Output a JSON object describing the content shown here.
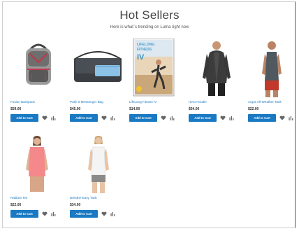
{
  "section": {
    "title": "Hot Sellers",
    "subtitle": "Here is what`s trending on Luma right now"
  },
  "products": [
    {
      "name": "Fusion Backpack",
      "price": "$59.00",
      "add_label": "Add to Cart",
      "image": "backpack"
    },
    {
      "name": "Push It Messenger Bag",
      "price": "$45.00",
      "add_label": "Add to Cart",
      "image": "messenger-bag"
    },
    {
      "name": "LifeLong Fitness IV",
      "price": "$14.00",
      "add_label": "Add to Cart",
      "image": "dvd-cover",
      "image_text": [
        "LIFELONG",
        "FITNESS",
        "IV"
      ]
    },
    {
      "name": "Hero Hoodie",
      "price": "$54.00",
      "add_label": "Add to Cart",
      "image": "hoodie"
    },
    {
      "name": "Argus All-Weather Tank",
      "price": "$22.00",
      "add_label": "Add to Cart",
      "image": "tank-man"
    },
    {
      "name": "Radiant Tee",
      "price": "$22.00",
      "add_label": "Add to Cart",
      "image": "tee-woman"
    },
    {
      "name": "Breathe-Easy Tank",
      "price": "$34.00",
      "add_label": "Add to Cart",
      "image": "tank-woman"
    }
  ],
  "icons": {
    "wishlist": "heart-icon",
    "compare": "compare-icon"
  },
  "colors": {
    "button": "#1979c3",
    "link": "#1979c3",
    "price": "#333333"
  }
}
